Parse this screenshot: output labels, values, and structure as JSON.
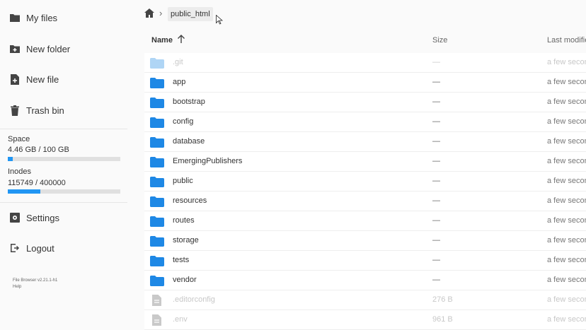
{
  "sidebar": {
    "items": [
      {
        "label": "My files",
        "icon": "folder-icon"
      },
      {
        "label": "New folder",
        "icon": "new-folder-icon"
      },
      {
        "label": "New file",
        "icon": "new-file-icon"
      },
      {
        "label": "Trash bin",
        "icon": "trash-icon"
      }
    ],
    "space": {
      "title": "Space",
      "value": "4.46 GB / 100 GB",
      "fraction": 0.0446
    },
    "inodes": {
      "title": "Inodes",
      "value": "115749 / 400000",
      "fraction": 0.2894
    },
    "settings": {
      "label": "Settings",
      "icon": "settings-icon"
    },
    "logout": {
      "label": "Logout",
      "icon": "logout-icon"
    },
    "footer": {
      "version": "File Browser v2.21.1-h1",
      "help": "Help"
    }
  },
  "breadcrumb": {
    "current": "public_html"
  },
  "table": {
    "columns": {
      "name": "Name",
      "size": "Size",
      "modified": "Last modifie"
    },
    "sort_direction": "ascending",
    "rows": [
      {
        "name": ".git",
        "size": "—",
        "modified": "a few secon",
        "type": "folder",
        "dim": true
      },
      {
        "name": "app",
        "size": "—",
        "modified": "a few secon",
        "type": "folder",
        "dim": false
      },
      {
        "name": "bootstrap",
        "size": "—",
        "modified": "a few secon",
        "type": "folder",
        "dim": false
      },
      {
        "name": "config",
        "size": "—",
        "modified": "a few secon",
        "type": "folder",
        "dim": false
      },
      {
        "name": "database",
        "size": "—",
        "modified": "a few secon",
        "type": "folder",
        "dim": false
      },
      {
        "name": "EmergingPublishers",
        "size": "—",
        "modified": "a few secon",
        "type": "folder",
        "dim": false
      },
      {
        "name": "public",
        "size": "—",
        "modified": "a few secon",
        "type": "folder",
        "dim": false
      },
      {
        "name": "resources",
        "size": "—",
        "modified": "a few secon",
        "type": "folder",
        "dim": false
      },
      {
        "name": "routes",
        "size": "—",
        "modified": "a few secon",
        "type": "folder",
        "dim": false
      },
      {
        "name": "storage",
        "size": "—",
        "modified": "a few secon",
        "type": "folder",
        "dim": false
      },
      {
        "name": "tests",
        "size": "—",
        "modified": "a few secon",
        "type": "folder",
        "dim": false
      },
      {
        "name": "vendor",
        "size": "—",
        "modified": "a few secon",
        "type": "folder",
        "dim": false
      },
      {
        "name": ".editorconfig",
        "size": "276 B",
        "modified": "a few secon",
        "type": "file",
        "dim": true
      },
      {
        "name": ".env",
        "size": "961 B",
        "modified": "a few secon",
        "type": "file",
        "dim": true
      }
    ]
  },
  "colors": {
    "accent": "#2196f3",
    "folder": "#1e88e5",
    "icon": "#444444"
  }
}
